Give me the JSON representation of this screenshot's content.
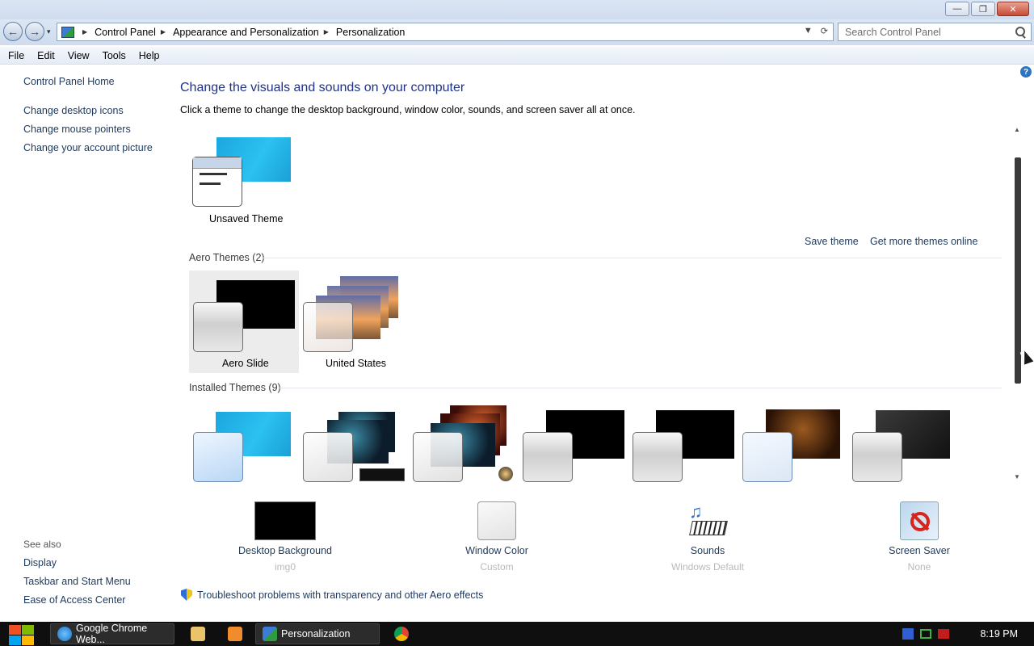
{
  "window": {
    "minimize_glyph": "—",
    "restore_glyph": "❐",
    "close_glyph": "✕"
  },
  "nav": {
    "back_glyph": "←",
    "forward_glyph": "→",
    "recent_glyph": "▾"
  },
  "breadcrumb": [
    "Control Panel",
    "Appearance and Personalization",
    "Personalization"
  ],
  "search": {
    "placeholder": "Search Control Panel"
  },
  "menu": [
    "File",
    "Edit",
    "View",
    "Tools",
    "Help"
  ],
  "sidebar": {
    "home": "Control Panel Home",
    "links": [
      "Change desktop icons",
      "Change mouse pointers",
      "Change your account picture"
    ],
    "see_also_title": "See also",
    "see_also": [
      "Display",
      "Taskbar and Start Menu",
      "Ease of Access Center"
    ]
  },
  "main": {
    "heading": "Change the visuals and sounds on your computer",
    "subheading": "Click a theme to change the desktop background, window color, sounds, and screen saver all at once.",
    "unsaved_theme": "Unsaved Theme",
    "save_theme": "Save theme",
    "get_more": "Get more themes online",
    "aero_section": "Aero Themes (2)",
    "aero_themes": [
      "Aero Slide",
      "United States"
    ],
    "installed_section": "Installed Themes (9)",
    "selected_theme": "Aero Slide"
  },
  "bottom": {
    "desktop_background": {
      "label": "Desktop Background",
      "value": "img0"
    },
    "window_color": {
      "label": "Window Color",
      "value": "Custom"
    },
    "sounds": {
      "label": "Sounds",
      "value": "Windows Default"
    },
    "screen_saver": {
      "label": "Screen Saver",
      "value": "None"
    },
    "troubleshoot": "Troubleshoot problems with transparency and other Aero effects"
  },
  "taskbar": {
    "tasks": [
      "Google Chrome Web...",
      "Personalization"
    ],
    "clock": "8:19 PM"
  },
  "colors": {
    "accent_link": "#1e395b",
    "heading": "#1e3287",
    "taskbar": "#0f0f0f"
  }
}
